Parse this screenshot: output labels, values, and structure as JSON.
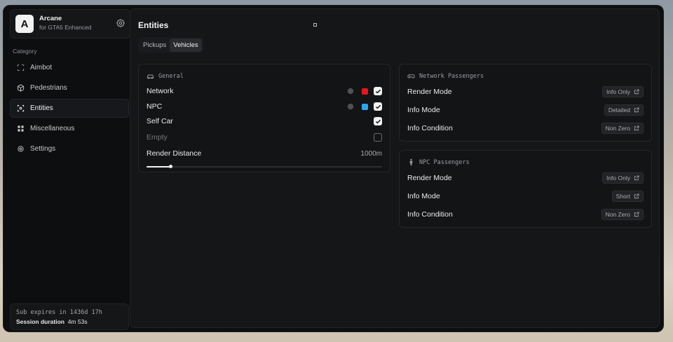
{
  "brand": {
    "title": "Arcane",
    "subtitle": "for GTA5 Enhanced",
    "logo_letter": "A"
  },
  "sidebar": {
    "category_label": "Category",
    "items": [
      {
        "label": "Aimbot",
        "icon": "crosshair-frame-icon",
        "active": false
      },
      {
        "label": "Pedestrians",
        "icon": "cube-icon",
        "active": false
      },
      {
        "label": "Entities",
        "icon": "entities-icon",
        "active": true
      },
      {
        "label": "Miscellaneous",
        "icon": "grid-icon",
        "active": false
      },
      {
        "label": "Settings",
        "icon": "gear-icon",
        "active": false
      }
    ]
  },
  "subscription": {
    "expires": "Sub expires in 1436d 17h",
    "session_label": "Session duration",
    "session_value": "4m 53s"
  },
  "main": {
    "title": "Entities",
    "tabs": [
      {
        "label": "Pickups",
        "active": false
      },
      {
        "label": "Vehicles",
        "active": true
      }
    ]
  },
  "general": {
    "title": "General",
    "icon": "car-icon",
    "rows": [
      {
        "label": "Network",
        "gear": true,
        "color": "#e8161b",
        "checked": true,
        "dim": false
      },
      {
        "label": "NPC",
        "gear": true,
        "color": "#2aa6f0",
        "checked": true,
        "dim": false
      },
      {
        "label": "Self Car",
        "gear": false,
        "color": null,
        "checked": true,
        "dim": false
      },
      {
        "label": "Empty",
        "gear": false,
        "color": null,
        "checked": false,
        "dim": true
      }
    ],
    "render_distance": {
      "label": "Render Distance",
      "value": "1000m",
      "fill_fraction": 0.1
    }
  },
  "network_passengers": {
    "title": "Network Passengers",
    "icon": "gamepad-icon",
    "rows": [
      {
        "label": "Render Mode",
        "value": "Info Only"
      },
      {
        "label": "Info Mode",
        "value": "Detailed"
      },
      {
        "label": "Info Condition",
        "value": "Non Zero"
      }
    ]
  },
  "npc_passengers": {
    "title": "NPC Passengers",
    "icon": "person-icon",
    "rows": [
      {
        "label": "Render Mode",
        "value": "Info Only"
      },
      {
        "label": "Info Mode",
        "value": "Short"
      },
      {
        "label": "Info Condition",
        "value": "Non Zero"
      }
    ]
  }
}
